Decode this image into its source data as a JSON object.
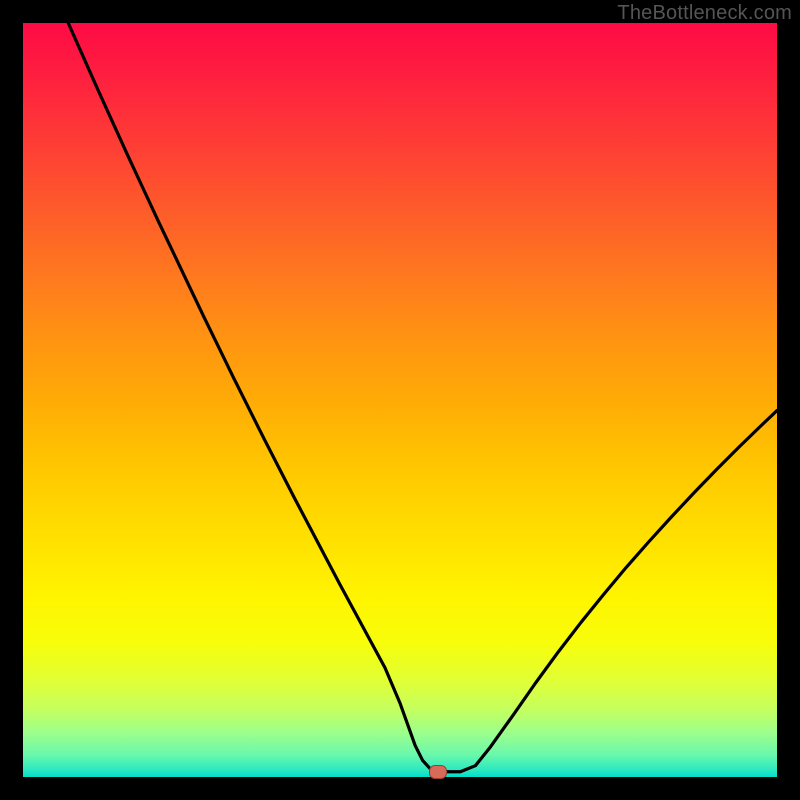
{
  "watermark": "TheBottleneck.com",
  "colors": {
    "curve": "#000000",
    "marker_fill": "#d86a5a",
    "marker_stroke": "#9e3e31",
    "gradient_top": "#fe0b45",
    "gradient_bottom": "#00dfc9",
    "page_bg": "#000000"
  },
  "chart_data": {
    "type": "line",
    "title": "",
    "xlabel": "",
    "ylabel": "",
    "xlim": [
      0,
      100
    ],
    "ylim": [
      0,
      100
    ],
    "series": [
      {
        "name": "bottleneck-curve",
        "x": [
          6,
          8,
          10,
          12,
          14,
          16,
          18,
          20,
          22,
          24,
          26,
          28,
          30,
          32,
          34,
          36,
          38,
          40,
          42,
          44,
          46,
          48,
          50,
          51,
          52,
          53,
          54,
          55,
          56,
          58,
          60,
          62,
          65,
          68,
          71,
          74,
          77,
          80,
          83,
          86,
          89,
          92,
          95,
          98,
          100
        ],
        "y": [
          100,
          95.5,
          91,
          86.6,
          82.2,
          77.9,
          73.6,
          69.4,
          65.2,
          61,
          56.9,
          52.8,
          48.8,
          44.8,
          40.9,
          37,
          33.2,
          29.4,
          25.6,
          21.9,
          18.2,
          14.5,
          9.8,
          7,
          4.2,
          2.2,
          1.1,
          0.7,
          0.7,
          0.7,
          1.5,
          4,
          8.2,
          12.5,
          16.6,
          20.5,
          24.2,
          27.8,
          31.2,
          34.5,
          37.7,
          40.8,
          43.8,
          46.7,
          48.6
        ]
      }
    ],
    "marker": {
      "x": 55,
      "y": 0.7
    },
    "annotations": []
  }
}
